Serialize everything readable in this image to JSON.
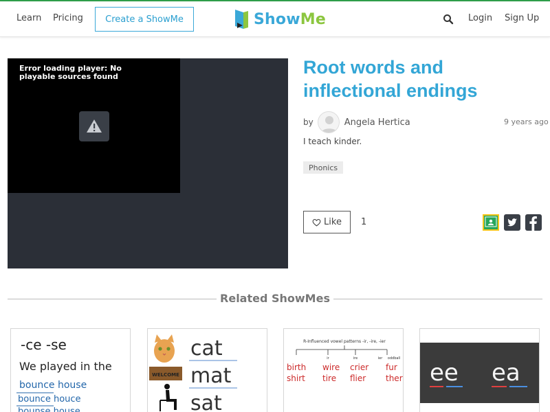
{
  "nav": {
    "learn": "Learn",
    "pricing": "Pricing",
    "create": "Create a ShowMe",
    "logo_show": "Show",
    "logo_me": "Me",
    "login": "Login",
    "signup": "Sign Up"
  },
  "player": {
    "error": "Error loading player: No playable sources found"
  },
  "showme": {
    "title": "Root words and inflectional endings",
    "by": "by",
    "author": "Angela Hertica",
    "time_ago": "9 years ago",
    "description": "I teach kinder.",
    "tag": "Phonics",
    "like_label": "Like",
    "like_count": "1"
  },
  "related": {
    "heading": "Related ShowMes",
    "cards": [
      {
        "lines": [
          "-ce   -se",
          "We played in the",
          "bounce house",
          "bounce  houce",
          "bounse  house"
        ]
      },
      {
        "words": [
          "cat",
          "mat",
          "sat"
        ],
        "mat_label": "WELCOME"
      },
      {
        "header": "R-Influenced vowel patterns -ir, -ire, -ier",
        "oddball": "oddball",
        "cols": [
          "ir",
          "ire",
          "ier"
        ],
        "row1": [
          "birth",
          "wire",
          "crier",
          "fur"
        ],
        "row2": [
          "shirt",
          "tire",
          "flier",
          "ther"
        ]
      },
      {
        "words": [
          "ee",
          "ea"
        ]
      }
    ]
  },
  "colors": {
    "brand_blue": "#33a6d6",
    "brand_green": "#8cc63f",
    "top_accent": "#2f9e4a"
  }
}
